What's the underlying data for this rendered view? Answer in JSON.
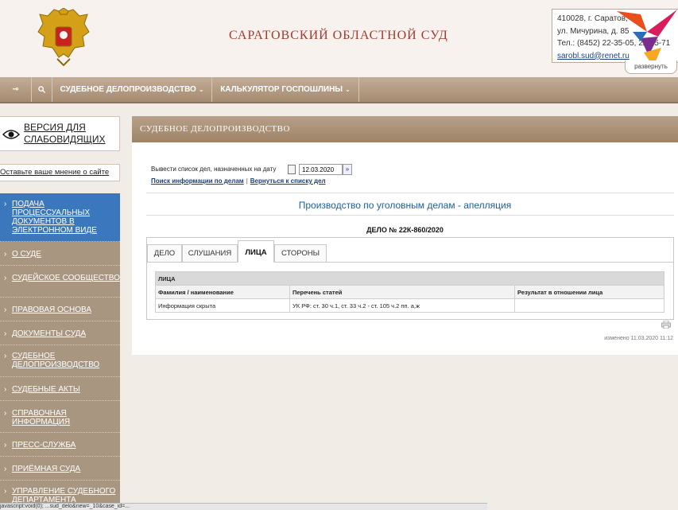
{
  "header": {
    "court_title": "САРАТОВСКИЙ ОБЛАСТНОЙ СУД",
    "contact": {
      "address_line1": "410028, г. Саратов,",
      "address_line2": "ул. Мичурина, д. 85",
      "phone": "Тел.: (8452) 22-35-05, 22-35-71",
      "email": "sarobl.sud@renet.ru"
    },
    "expand_label": "развернуть"
  },
  "navbar": {
    "items": [
      {
        "label": "СУДЕБНОЕ ДЕЛОПРОИЗВОДСТВО"
      },
      {
        "label": "КАЛЬКУЛЯТОР ГОСПОШЛИНЫ"
      }
    ]
  },
  "left": {
    "vision_label": "ВЕРСИЯ ДЛЯ СЛАБОВИДЯЩИХ",
    "feedback_label": "Оставьте ваше мнение о сайте",
    "menu": [
      {
        "label": "ПОДАЧА ПРОЦЕССУАЛЬНЫХ ДОКУМЕНТОВ В ЭЛЕКТРОННОМ ВИДЕ"
      },
      {
        "label": "О СУДЕ"
      },
      {
        "label": "СУДЕЙСКОЕ СООБЩЕСТВО"
      },
      {
        "label": "ПРАВОВАЯ ОСНОВА"
      },
      {
        "label": "ДОКУМЕНТЫ СУДА"
      },
      {
        "label": "СУДЕБНОЕ ДЕЛОПРОИЗВОДСТВО"
      },
      {
        "label": "СУДЕБНЫЕ АКТЫ"
      },
      {
        "label": "СПРАВОЧНАЯ ИНФОРМАЦИЯ"
      },
      {
        "label": "ПРЕСС-СЛУЖБА"
      },
      {
        "label": "ПРИЁМНАЯ СУДА"
      },
      {
        "label": "УПРАВЛЕНИЕ СУДЕБНОГО ДЕПАРТАМЕНТА"
      }
    ]
  },
  "content": {
    "panel_title": "СУДЕБНОЕ ДЕЛОПРОИЗВОДСТВО",
    "date_label": "Вывести список дел, назначенных на дату",
    "date_value": "12.03.2020",
    "link_search": "Поиск информации по делам",
    "link_sep": "|",
    "link_back": "Вернуться к списку дел",
    "section_title": "Производство по уголовным делам - апелляция",
    "case_title": "ДЕЛО № 22К-860/2020",
    "tabs": [
      {
        "label": "ДЕЛО"
      },
      {
        "label": "СЛУШАНИЯ"
      },
      {
        "label": "ЛИЦА"
      },
      {
        "label": "СТОРОНЫ"
      }
    ],
    "persons_table": {
      "section_label": "ЛИЦА",
      "headers": [
        "Фамилия / наименование",
        "Перечень статей",
        "Результат в отношении лица"
      ],
      "rows": [
        [
          "Информация скрыта",
          "УК РФ: ст. 30 ч.1, ст. 33 ч.2 - ст. 105 ч.2 пп. а,ж",
          ""
        ]
      ]
    },
    "modified": "изменено 11.03.2020 11:12"
  },
  "statusbar": {
    "text": "javascript:void(0);     ...sud_delo&new=_10&case_id=..."
  },
  "colors": {
    "accent_red": "#9e3b2e",
    "nav_brown": "#a68b70",
    "sidebar_active": "#3a77bd",
    "link_blue": "#1a3f80"
  }
}
